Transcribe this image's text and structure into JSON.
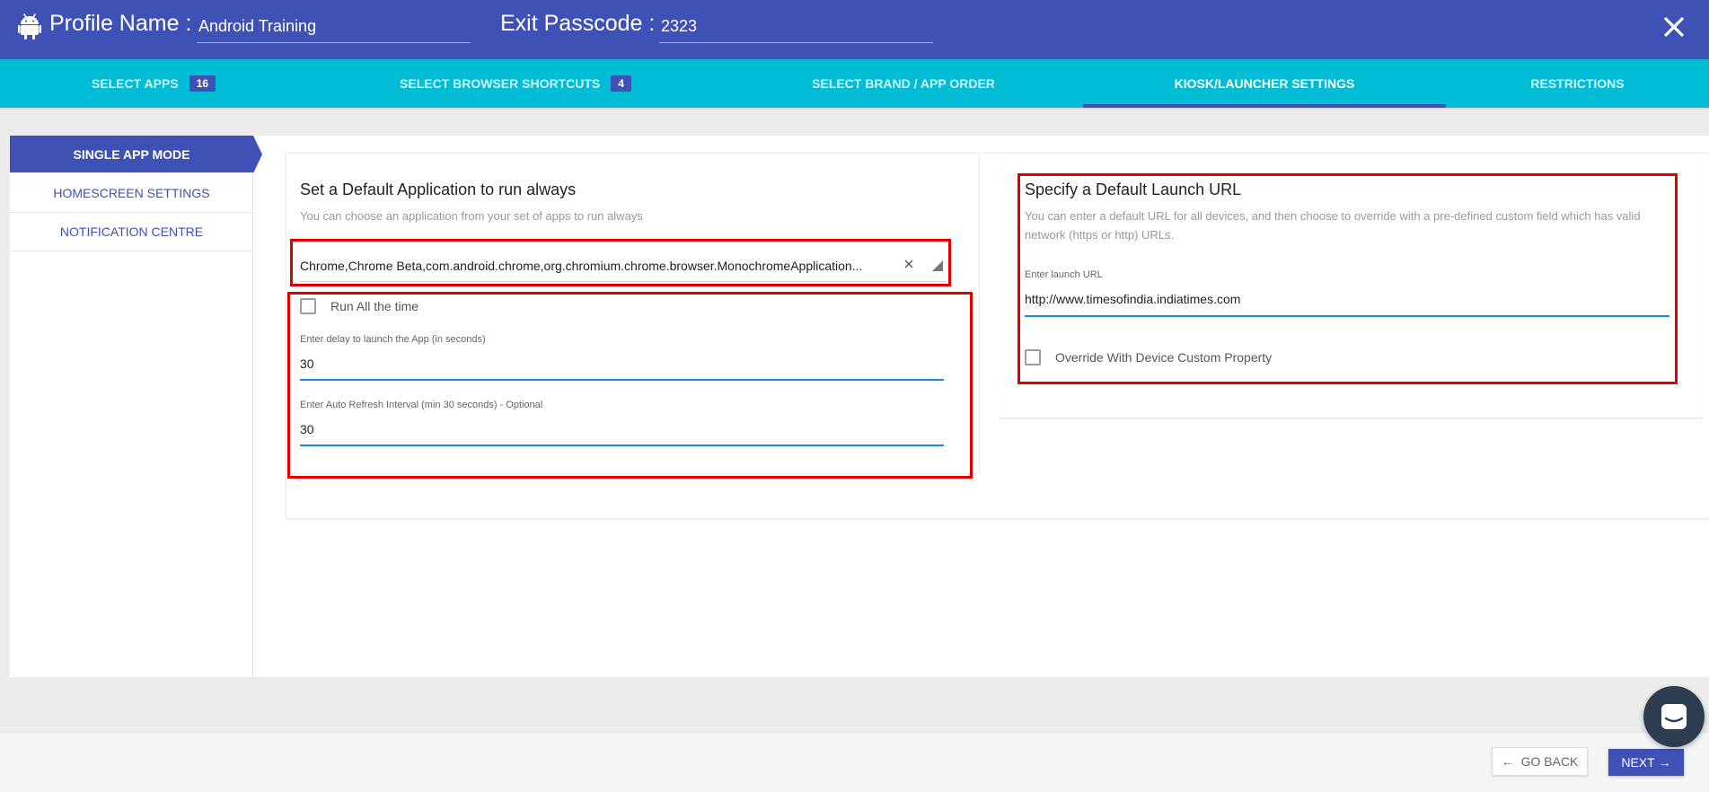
{
  "header": {
    "profile_name_label": "Profile Name :",
    "profile_name_value": "Android Training",
    "exit_passcode_label": "Exit Passcode :",
    "exit_passcode_value": "2323"
  },
  "tabs": [
    {
      "label": "SELECT APPS",
      "badge": "16"
    },
    {
      "label": "SELECT BROWSER SHORTCUTS",
      "badge": "4"
    },
    {
      "label": "SELECT BRAND / APP ORDER"
    },
    {
      "label": "KIOSK/LAUNCHER SETTINGS",
      "active": true
    },
    {
      "label": "RESTRICTIONS"
    }
  ],
  "sidebar": {
    "items": [
      {
        "label": "SINGLE APP MODE",
        "active": true
      },
      {
        "label": "HOMESCREEN SETTINGS"
      },
      {
        "label": "NOTIFICATION CENTRE"
      }
    ]
  },
  "default_app": {
    "title": "Set a Default Application to run always",
    "description": "You can choose an application from your set of apps to run always",
    "selected_app": "Chrome,Chrome Beta,com.android.chrome,org.chromium.chrome.browser.MonochromeApplication...",
    "run_all_time_label": "Run All the time",
    "run_all_time_checked": false,
    "delay_label": "Enter delay to launch the App (in seconds)",
    "delay_value": "30",
    "refresh_label": "Enter Auto Refresh Interval (min 30 seconds) - Optional",
    "refresh_value": "30"
  },
  "launch_url": {
    "title": "Specify a Default Launch URL",
    "description": "You can enter a default URL for all devices, and then choose to override with a pre-defined custom field which has valid network (https or http) URLs.",
    "url_label": "Enter launch URL",
    "url_value": "http://www.timesofindia.indiatimes.com",
    "override_label": "Override With Device Custom Property",
    "override_checked": false
  },
  "footer": {
    "go_back_label": "GO BACK",
    "next_label": "NEXT"
  },
  "colors": {
    "primary": "#3f51b5",
    "tabs_bg": "#00bcd4",
    "focus_underline": "#1e88e5",
    "highlight_box": "#e00000"
  }
}
